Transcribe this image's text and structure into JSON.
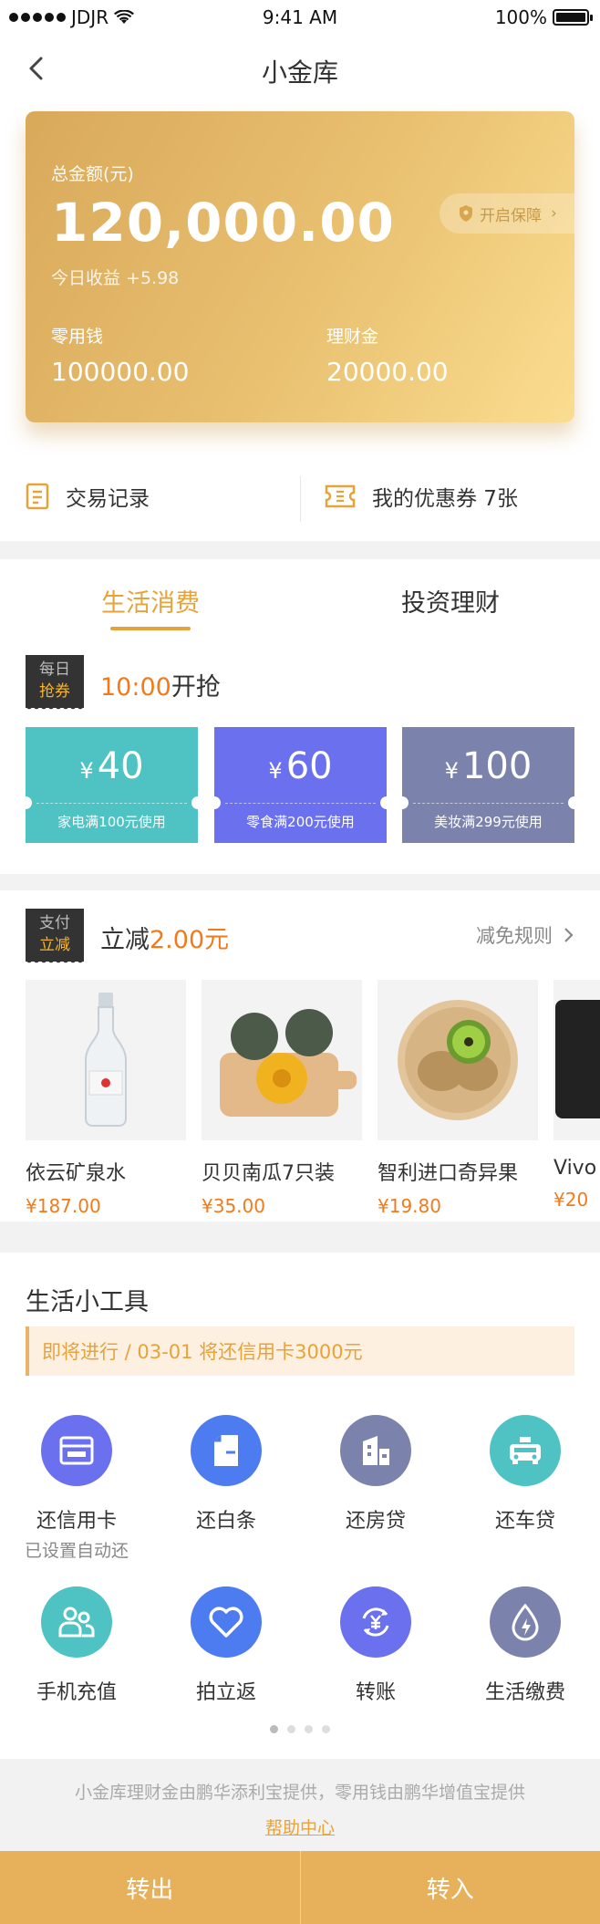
{
  "status_bar": {
    "carrier": "JDJR",
    "time": "9:41 AM",
    "battery": "100%"
  },
  "nav": {
    "title": "小金库"
  },
  "card": {
    "total_label": "总金额(元)",
    "total_amount": "120,000.00",
    "today_income": "今日收益 +5.98",
    "protect_label": "开启保障",
    "pocket_label": "零用钱",
    "pocket_value": "100000.00",
    "finance_label": "理财金",
    "finance_value": "20000.00"
  },
  "quick_actions": {
    "records": "交易记录",
    "coupons": "我的优惠券 7张"
  },
  "tabs": [
    {
      "label": "生活消费"
    },
    {
      "label": "投资理财"
    }
  ],
  "daily_coupon": {
    "badge_top": "每日",
    "badge_bottom": "抢券",
    "time": "10:00",
    "suffix": "开抢",
    "coupons": [
      {
        "currency": "¥",
        "amount": "40",
        "condition": "家电满100元使用",
        "color": "#4fc3c3"
      },
      {
        "currency": "¥",
        "amount": "60",
        "condition": "零食满200元使用",
        "color": "#6a70ee"
      },
      {
        "currency": "¥",
        "amount": "100",
        "condition": "美妆满299元使用",
        "color": "#7b83ad"
      }
    ]
  },
  "pay_discount": {
    "badge_top": "支付",
    "badge_bottom": "立减",
    "prefix": "立减",
    "amount": "2.00元",
    "rules": "减免规则",
    "products": [
      {
        "name": "依云矿泉水",
        "price": "¥187.00"
      },
      {
        "name": "贝贝南瓜7只装",
        "price": "¥35.00"
      },
      {
        "name": "智利进口奇异果",
        "price": "¥19.80"
      },
      {
        "name": "Vivo",
        "price": "¥20"
      }
    ]
  },
  "tools": {
    "title": "生活小工具",
    "notice": "即将进行 / 03-01 将还信用卡3000元",
    "items": [
      {
        "label": "还信用卡",
        "sub": "已设置自动还",
        "icon": "credit-card-icon",
        "color": "#6a70ee"
      },
      {
        "label": "还白条",
        "icon": "note-icon",
        "color": "#4d7bf0"
      },
      {
        "label": "还房贷",
        "icon": "building-icon",
        "color": "#7b83ad"
      },
      {
        "label": "还车贷",
        "icon": "taxi-icon",
        "color": "#4fc3c3"
      },
      {
        "label": "手机充值",
        "icon": "people-icon",
        "color": "#4fc3c3"
      },
      {
        "label": "拍立返",
        "icon": "heart-icon",
        "color": "#4d7bf0"
      },
      {
        "label": "转账",
        "icon": "yuan-transfer-icon",
        "color": "#6a70ee"
      },
      {
        "label": "生活缴费",
        "icon": "water-drop-icon",
        "color": "#7b83ad"
      }
    ]
  },
  "footer": {
    "note": "小金库理财金由鹏华添利宝提供，零用钱由鹏华增值宝提供",
    "help": "帮助中心"
  },
  "bottom_bar": {
    "out": "转出",
    "in": "转入"
  }
}
